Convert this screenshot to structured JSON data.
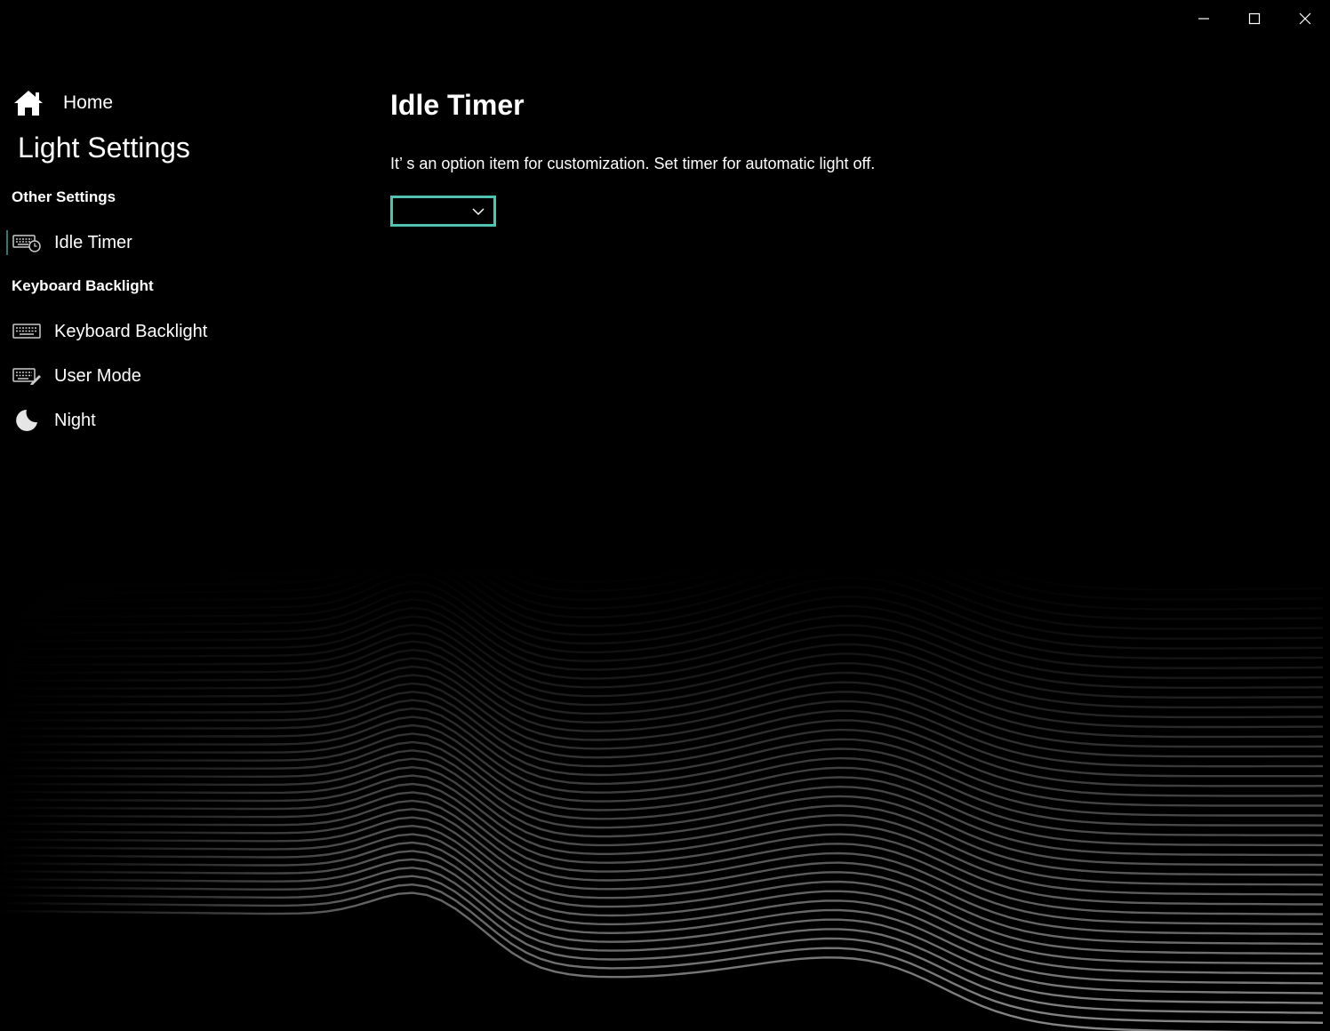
{
  "window": {
    "controls": {
      "minimize_icon": "minimize-icon",
      "maximize_icon": "maximize-icon",
      "close_icon": "close-icon"
    }
  },
  "sidebar": {
    "home": {
      "label": "Home",
      "icon": "home-icon"
    },
    "section_title": "Light Settings",
    "groups": [
      {
        "header": "Other Settings",
        "items": [
          {
            "label": "Idle Timer",
            "icon": "keyboard-clock-icon",
            "selected": true
          }
        ]
      },
      {
        "header": "Keyboard Backlight",
        "items": [
          {
            "label": "Keyboard Backlight",
            "icon": "keyboard-icon",
            "selected": false
          },
          {
            "label": "User Mode",
            "icon": "keyboard-edit-icon",
            "selected": false
          },
          {
            "label": "Night",
            "icon": "moon-icon",
            "selected": false
          }
        ]
      }
    ]
  },
  "main": {
    "title": "Idle Timer",
    "description": "It’   s an option item for customization. Set timer for automatic light off.",
    "timer_dropdown": {
      "value": "",
      "icon": "chevron-down-icon"
    }
  },
  "colors": {
    "background": "#000000",
    "accent": "#4fc3b2",
    "text": "#ffffff"
  }
}
